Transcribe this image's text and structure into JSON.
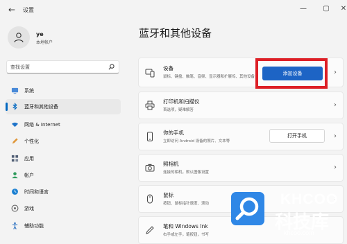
{
  "window": {
    "app_title": "设置",
    "back_icon": "back-arrow-icon",
    "controls": [
      "minimize-icon",
      "maximize-icon",
      "close-icon"
    ]
  },
  "user": {
    "name": "ye",
    "account_type": "本地帐户"
  },
  "search": {
    "placeholder": "查找设置"
  },
  "sidebar": {
    "items": [
      {
        "label": "系统",
        "icon": "monitor-icon",
        "color": "#4a8ad8"
      },
      {
        "label": "蓝牙和其他设备",
        "icon": "bluetooth-icon",
        "color": "#0067c0",
        "active": true
      },
      {
        "label": "网络 & Internet",
        "icon": "wifi-icon",
        "color": "#1f74c9"
      },
      {
        "label": "个性化",
        "icon": "pen-icon",
        "color": "#e0973a"
      },
      {
        "label": "应用",
        "icon": "apps-icon",
        "color": "#4f5d73"
      },
      {
        "label": "帐户",
        "icon": "person-icon",
        "color": "#2e9b5c"
      },
      {
        "label": "时间和语言",
        "icon": "globe-clock-icon",
        "color": "#1a7fd1"
      },
      {
        "label": "游戏",
        "icon": "game-icon",
        "color": "#666666"
      },
      {
        "label": "辅助功能",
        "icon": "accessibility-icon",
        "color": "#2a6fc0"
      }
    ]
  },
  "main": {
    "title": "蓝牙和其他设备",
    "cards": [
      {
        "title": "设备",
        "subtitle": "鼠标、键盘、触笔、音频、显示器和扩展坞、其他设备",
        "icon": "devices-icon",
        "action_label": "添加设备"
      },
      {
        "title": "打印机和扫描仪",
        "subtitle": "首选项，疑难解答",
        "icon": "printer-icon"
      },
      {
        "title": "你的手机",
        "subtitle": "立即访问 Android 设备的照片、文本等",
        "icon": "phone-icon",
        "action_label": "打开手机"
      },
      {
        "title": "照相机",
        "subtitle": "连接的相机，默认图像设置",
        "icon": "camera-icon"
      },
      {
        "title": "鼠标",
        "subtitle": "按钮、鼠标指针速度、滚动",
        "icon": "mouse-icon"
      },
      {
        "title": "笔和 Windows Ink",
        "subtitle": "右手或左手，笔按钮，书写",
        "icon": "pen-ink-icon"
      }
    ]
  },
  "watermark": {
    "logo": "KHCOO",
    "text": "科技库",
    "url": "khcoo.com"
  },
  "colors": {
    "accent": "#1d64c5",
    "highlight": "#dd1f26",
    "background": "#f3f3f3"
  }
}
